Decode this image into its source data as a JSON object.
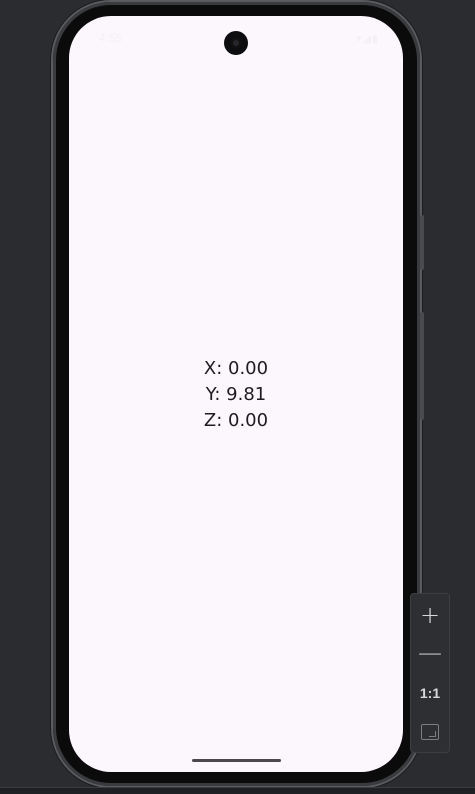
{
  "status_bar": {
    "time": "4:55",
    "icons": "▾◢▮"
  },
  "sensor": {
    "x_line": "X: 0.00",
    "y_line": "Y: 9.81",
    "z_line": "Z: 0.00"
  },
  "zoom_toolbar": {
    "zoom_in": "+",
    "zoom_out": "—",
    "reset": "1:1"
  }
}
